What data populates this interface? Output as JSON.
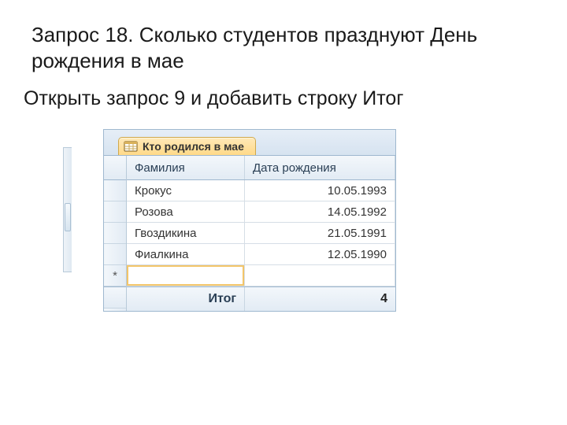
{
  "title": "Запрос 18. Сколько студентов празднуют День рождения в мае",
  "subtitle": "Открыть запрос 9 и добавить строку Итог",
  "tab": {
    "label": "Кто родился в мае"
  },
  "columns": {
    "surname": "Фамилия",
    "birthdate": "Дата рождения"
  },
  "rows": [
    {
      "surname": "Крокус",
      "birthdate": "10.05.1993"
    },
    {
      "surname": "Розова",
      "birthdate": "14.05.1992"
    },
    {
      "surname": "Гвоздикина",
      "birthdate": "21.05.1991"
    },
    {
      "surname": "Фиалкина",
      "birthdate": "12.05.1990"
    }
  ],
  "newrow_marker": "*",
  "total": {
    "label": "Итог",
    "value": "4"
  }
}
